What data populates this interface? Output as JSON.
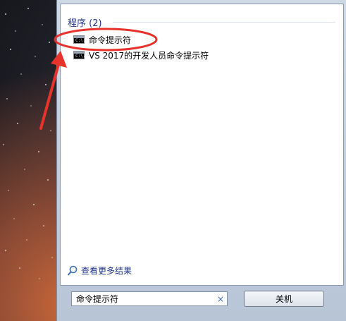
{
  "start_menu": {
    "section_header": "程序 (2)",
    "programs": [
      {
        "label": "命令提示符",
        "icon": "cmd-icon"
      },
      {
        "label": "VS 2017的开发人员命令提示符",
        "icon": "cmd-icon"
      }
    ],
    "see_more_label": "查看更多结果",
    "search": {
      "value": "命令提示符",
      "clear_icon": "×"
    },
    "shutdown_label": "关机"
  },
  "cmd_icon_text": "C:\\.",
  "colors": {
    "annotation": "#e8332d",
    "header_text": "#1e3287"
  }
}
